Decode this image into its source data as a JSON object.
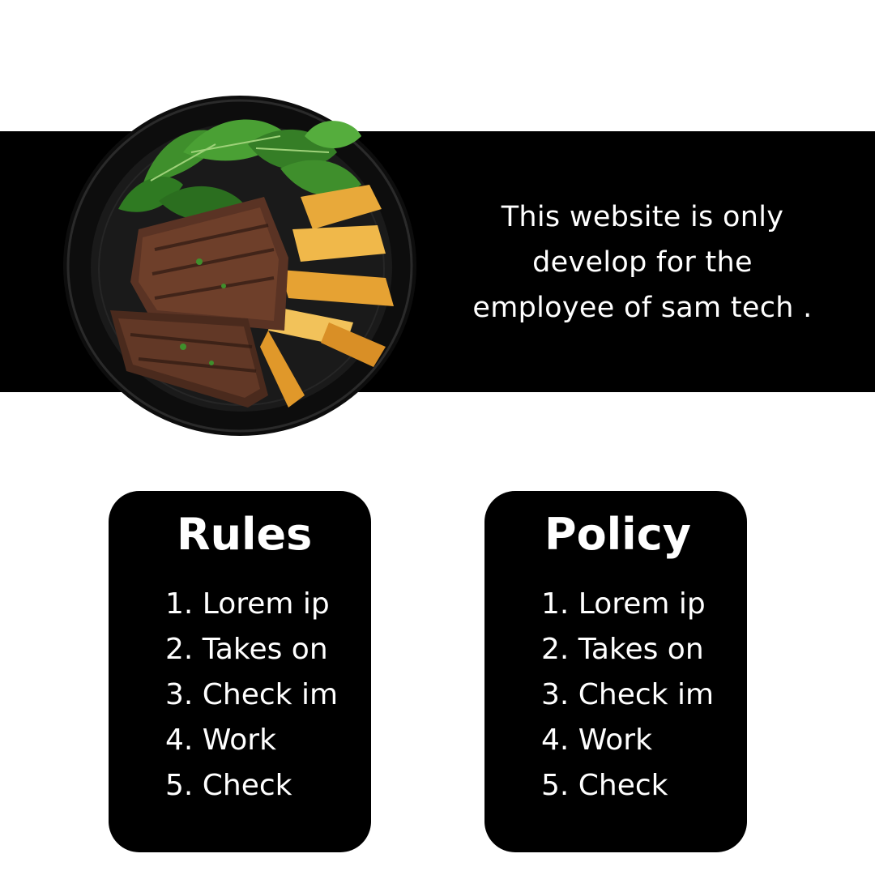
{
  "intro": {
    "text": "This  website is only\ndevelop for the\nemployee of sam tech ."
  },
  "hero_image": {
    "subject": "plate of grilled steak with roasted potato wedges and green salad"
  },
  "colors": {
    "background": "#ffffff",
    "banner": "#000000",
    "card": "#000000",
    "text_on_dark": "#ffffff"
  },
  "rules": {
    "title": "Rules",
    "items": [
      "1. Lorem ip",
      "2. Takes on",
      "3. Check im",
      "4. Work",
      "5.  Check"
    ]
  },
  "policy": {
    "title": "Policy",
    "items": [
      "1. Lorem ip",
      "2. Takes on",
      "3. Check im",
      "4. Work",
      "5.  Check"
    ]
  }
}
